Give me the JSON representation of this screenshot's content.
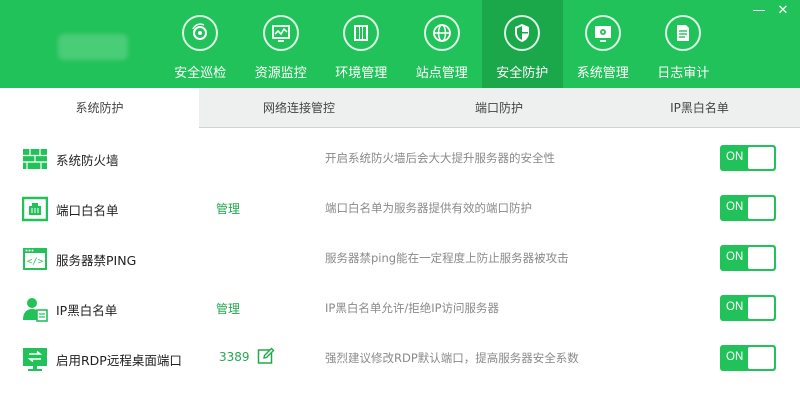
{
  "window": {
    "minimize": "—",
    "close": "✕"
  },
  "nav": [
    {
      "label": "安全巡检",
      "icon": "patrol-icon"
    },
    {
      "label": "资源监控",
      "icon": "monitor-icon"
    },
    {
      "label": "环境管理",
      "icon": "server-icon"
    },
    {
      "label": "站点管理",
      "icon": "globe-icon"
    },
    {
      "label": "安全防护",
      "icon": "shield-icon",
      "active": true
    },
    {
      "label": "系统管理",
      "icon": "settings-screen-icon"
    },
    {
      "label": "日志审计",
      "icon": "log-icon"
    }
  ],
  "tabs": [
    {
      "label": "系统防护",
      "active": true
    },
    {
      "label": "网络连接管控"
    },
    {
      "label": "端口防护"
    },
    {
      "label": "IP黑白名单"
    }
  ],
  "rows": [
    {
      "title": "系统防火墙",
      "desc": "开启系统防火墙后会大大提升服务器的安全性",
      "toggle": "ON",
      "icon": "firewall-icon"
    },
    {
      "title": "端口白名单",
      "link": "管理",
      "desc": "端口白名单为服务器提供有效的端口防护",
      "toggle": "ON",
      "icon": "port-icon"
    },
    {
      "title": "服务器禁PING",
      "desc": "服务器禁ping能在一定程度上防止服务器被攻击",
      "toggle": "ON",
      "icon": "code-window-icon"
    },
    {
      "title": "IP黑白名单",
      "link": "管理",
      "desc": "IP黑白名单允许/拒绝IP访问服务器",
      "toggle": "ON",
      "icon": "user-list-icon"
    },
    {
      "title": "启用RDP远程桌面端口",
      "port": "3389",
      "desc": "强烈建议修改RDP默认端口，提高服务器安全系数",
      "toggle": "ON",
      "icon": "remote-desktop-icon"
    }
  ],
  "colors": {
    "brand": "#22c25a",
    "brand_dark": "#1aa84a",
    "link": "#22a94f"
  }
}
